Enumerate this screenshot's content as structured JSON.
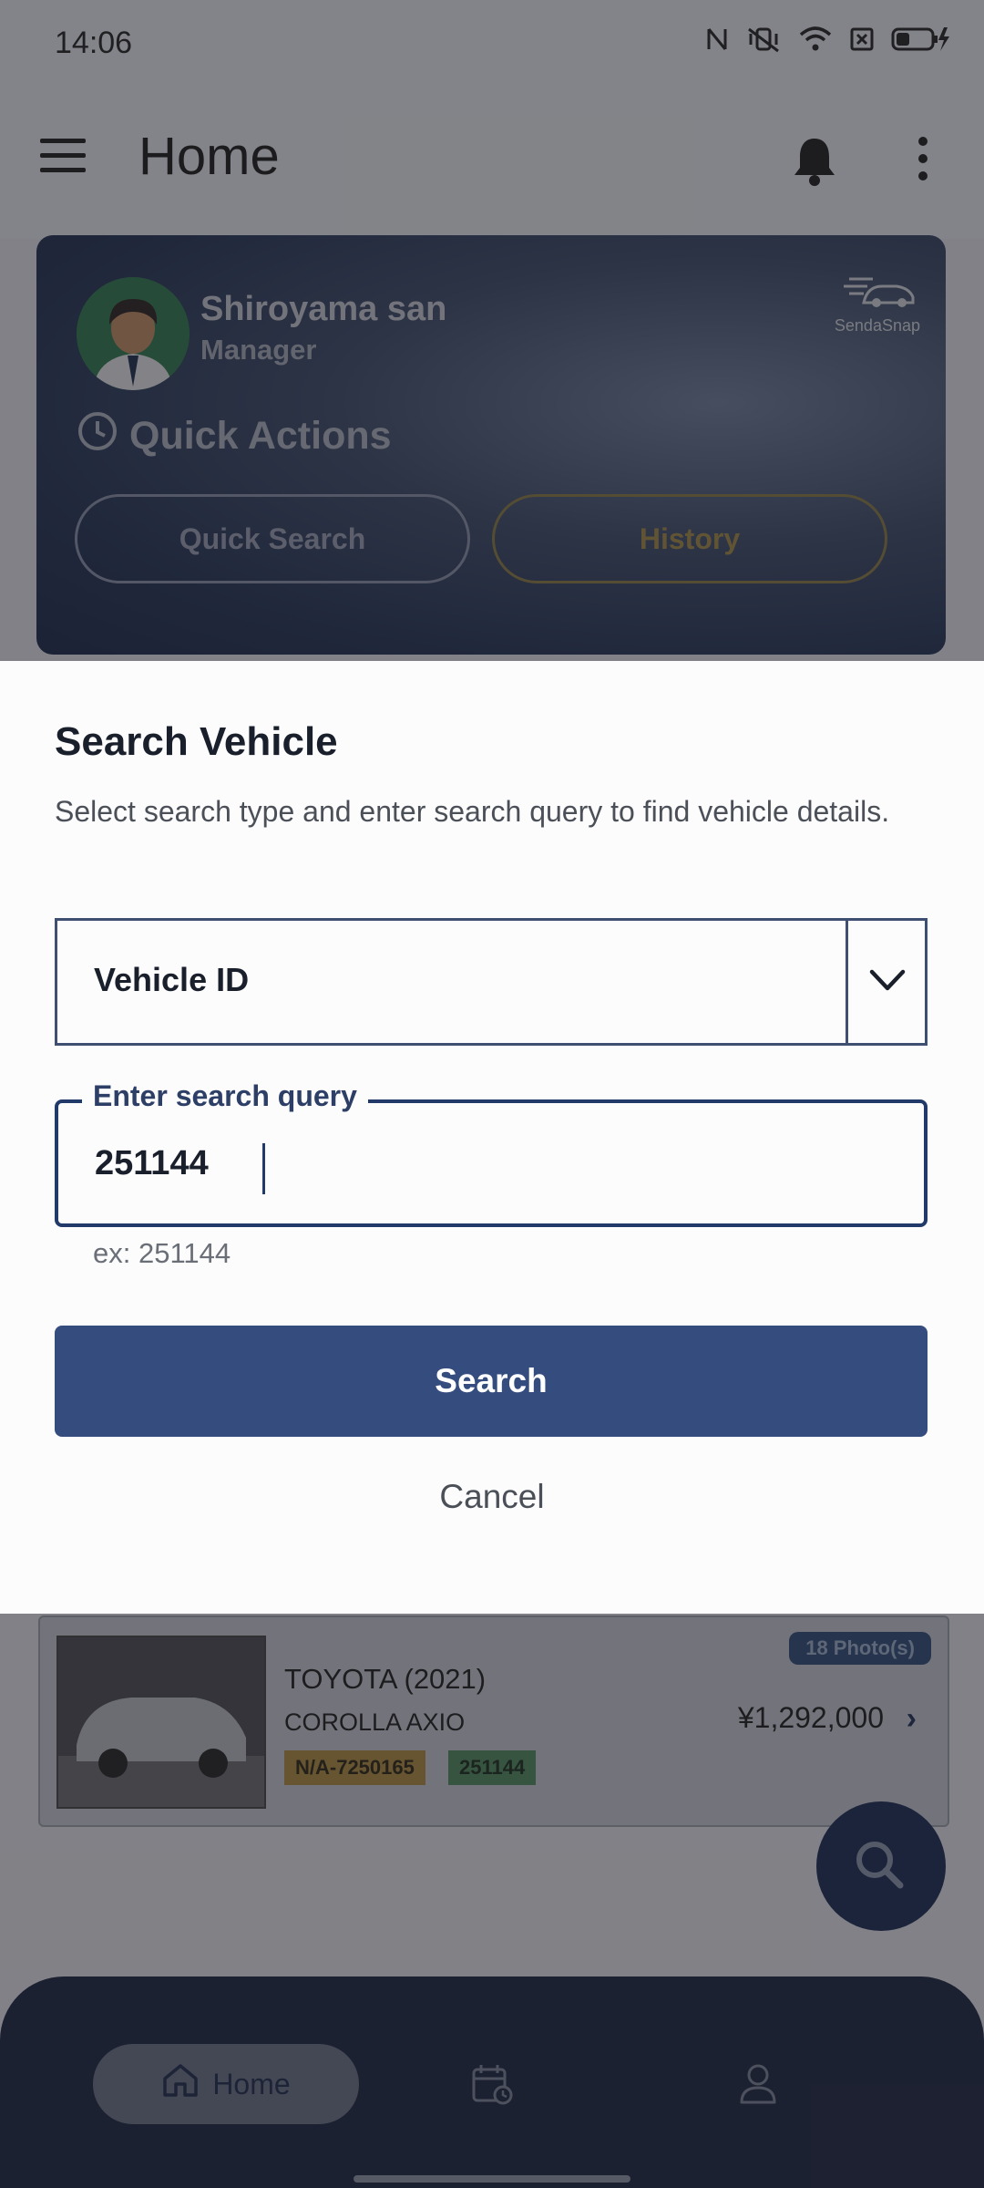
{
  "status_bar": {
    "time": "14:06"
  },
  "app_bar": {
    "title": "Home"
  },
  "profile": {
    "name": "Shiroyama san",
    "role": "Manager",
    "brand": "SendaSnap"
  },
  "quick_actions": {
    "title": "Quick Actions",
    "quick_search": "Quick Search",
    "history": "History"
  },
  "dialog": {
    "title": "Search Vehicle",
    "description": "Select search type and enter search query to find vehicle details.",
    "search_type": "Vehicle ID",
    "query_label": "Enter search query",
    "query_value": "251144",
    "hint": "ex: 251144",
    "search_label": "Search",
    "cancel_label": "Cancel"
  },
  "listing": {
    "make_year": "TOYOTA  (2021)",
    "model": "COROLLA AXIO",
    "tag_code": "N/A-7250165",
    "tag_id": "251144",
    "photos": "18 Photo(s)",
    "price": "¥1,292,000"
  },
  "bottom_nav": {
    "home_label": "Home"
  },
  "colors": {
    "primary": "#354c7e",
    "nav_bg": "#1b2540",
    "accent_gold": "#b08d3e",
    "accent_green": "#4e8a5a"
  }
}
